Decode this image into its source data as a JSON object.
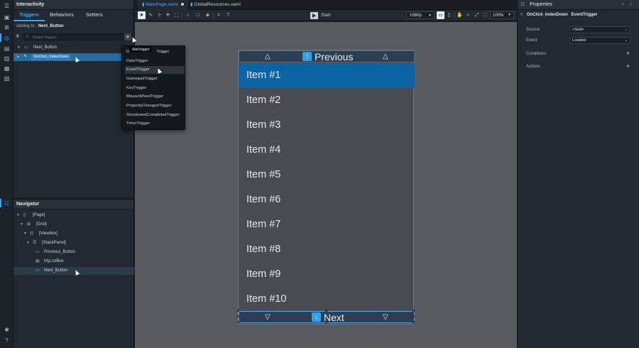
{
  "interactivity": {
    "title": "Interactivity",
    "tabs": [
      {
        "label": "Triggers",
        "active": true
      },
      {
        "label": "Behaviors",
        "active": false
      },
      {
        "label": "Setters",
        "active": false
      }
    ],
    "adding_label": "Adding to:",
    "adding_target": "Next_Button",
    "search_placeholder": "Search triggers",
    "add_tooltip": "Add trigger",
    "tree": [
      {
        "label": "Next_Button",
        "icon": "button-icon",
        "selected": false
      },
      {
        "label": "OnClick_IndexDown",
        "icon": "lightning-icon",
        "selected": true
      }
    ]
  },
  "trigger_menu": {
    "items": [
      "DataTrigger",
      "DataTrigger",
      "EventTrigger",
      "GamepadTrigger",
      "KeyTrigger",
      "MouseWheelTrigger",
      "PropertyChangedTrigger",
      "StoryboardCompletedTrigger",
      "TimerTrigger"
    ],
    "first_visible_fragment": "D",
    "first_visible_tail": "Trigger",
    "highlighted": "EventTrigger"
  },
  "navigator": {
    "title": "Navigator",
    "tree": [
      {
        "label": "[Page]",
        "depth": 0
      },
      {
        "label": "[Grid]",
        "depth": 1
      },
      {
        "label": "[Viewbox]",
        "depth": 2
      },
      {
        "label": "[StackPanel]",
        "depth": 3
      },
      {
        "label": "Previous_Button",
        "depth": 4
      },
      {
        "label": "MyListBox",
        "depth": 4
      },
      {
        "label": "Next_Button",
        "depth": 4,
        "selected": true
      }
    ]
  },
  "documents": {
    "tabs": [
      {
        "label": "MainPage.xaml",
        "active": true,
        "modified": true
      },
      {
        "label": "GlobalResources.xaml",
        "active": false
      }
    ]
  },
  "toolbar": {
    "start_label": "Start",
    "resolution": "1080p",
    "zoom": "100%"
  },
  "device": {
    "previous_label": "Previous",
    "next_label": "Next",
    "items": [
      "Item #1",
      "Item #2",
      "Item #3",
      "Item #4",
      "Item #5",
      "Item #6",
      "Item #7",
      "Item #8",
      "Item #9",
      "Item #10"
    ],
    "selected_item": "Item #1"
  },
  "properties": {
    "title": "Properties",
    "object_name": "OnClick_IndexDown",
    "object_type": "EventTrigger",
    "source_label": "Source",
    "source_value": "<Self>",
    "event_label": "Event",
    "event_value": "Loaded",
    "conditions_label": "Conditions",
    "actions_label": "Actions"
  },
  "colors": {
    "accent": "#31a8ff",
    "selection": "#1f6ea8",
    "list_selected": "#0a64a3",
    "canvas": "#575b60"
  }
}
